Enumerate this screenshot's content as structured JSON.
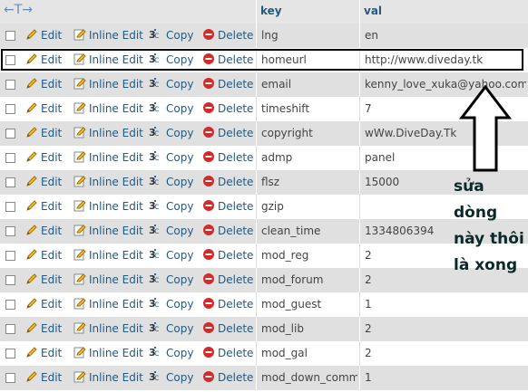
{
  "header": {
    "nav_symbol": "←T→",
    "col_key": "key",
    "col_val": "val"
  },
  "actions": {
    "edit": "Edit",
    "inline_edit": "Inline Edit",
    "copy": "Copy",
    "delete": "Delete"
  },
  "rows": [
    {
      "key": "lng",
      "val": "en"
    },
    {
      "key": "homeurl",
      "val": "http://www.diveday.tk"
    },
    {
      "key": "email",
      "val": "kenny_love_xuka@yahoo.com"
    },
    {
      "key": "timeshift",
      "val": "7"
    },
    {
      "key": "copyright",
      "val": "wWw.DiveDay.Tk"
    },
    {
      "key": "admp",
      "val": "panel"
    },
    {
      "key": "flsz",
      "val": "15000"
    },
    {
      "key": "gzip",
      "val": ""
    },
    {
      "key": "clean_time",
      "val": "1334806394"
    },
    {
      "key": "mod_reg",
      "val": "2"
    },
    {
      "key": "mod_forum",
      "val": "2"
    },
    {
      "key": "mod_guest",
      "val": "1"
    },
    {
      "key": "mod_lib",
      "val": "2"
    },
    {
      "key": "mod_gal",
      "val": "2"
    },
    {
      "key": "mod_down_comm",
      "val": "1"
    }
  ],
  "annotation": {
    "line1": "sửa",
    "line2": "dòng",
    "line3": "này thôi",
    "line4": "là xong"
  },
  "colors": {
    "link": "#235a81",
    "row_alt": "#e0e0e0",
    "header_bg": "#e5e5e5",
    "delete_red": "#d42a2a"
  }
}
